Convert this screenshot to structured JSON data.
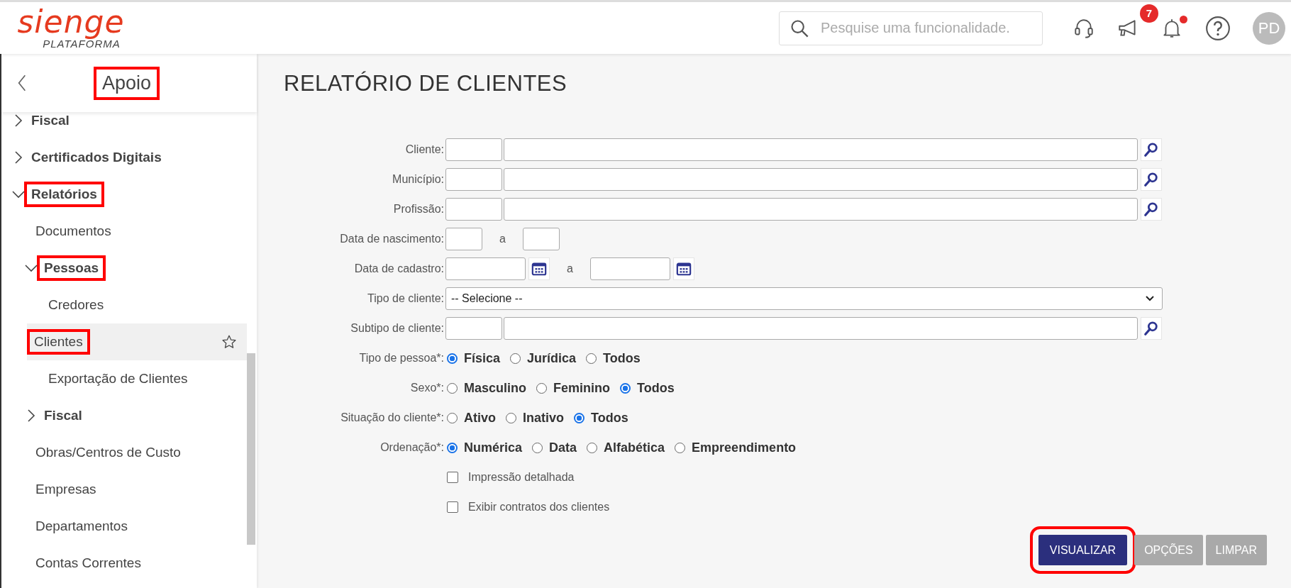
{
  "header": {
    "logo": "sienge",
    "logo_subtitle": "PLATAFORMA",
    "search": {
      "placeholder": "Pesquise uma funcionalidade."
    },
    "announcements_badge": "7",
    "notifications_unread": true,
    "avatar": "PD"
  },
  "sidebar": {
    "title": "Apoio",
    "title_highlighted": true,
    "items": [
      {
        "label": "Fiscal",
        "kind": "folder",
        "expanded": false,
        "highlighted": false
      },
      {
        "label": "Certificados Digitais",
        "kind": "folder",
        "expanded": false,
        "highlighted": false
      },
      {
        "label": "Relatórios",
        "kind": "folder",
        "expanded": true,
        "highlighted": true,
        "children": [
          {
            "label": "Documentos",
            "kind": "leaf",
            "highlighted": false,
            "selected": false
          },
          {
            "label": "Pessoas",
            "kind": "folder",
            "expanded": true,
            "highlighted": true,
            "children": [
              {
                "label": "Credores",
                "kind": "leaf",
                "highlighted": false,
                "selected": false
              },
              {
                "label": "Clientes",
                "kind": "leaf",
                "highlighted": true,
                "selected": true
              },
              {
                "label": "Exportação de Clientes",
                "kind": "leaf",
                "highlighted": false,
                "selected": false
              }
            ]
          },
          {
            "label": "Fiscal",
            "kind": "folder",
            "expanded": false,
            "highlighted": false
          },
          {
            "label": "Obras/Centros de Custo",
            "kind": "leaf",
            "highlighted": false,
            "selected": false
          },
          {
            "label": "Empresas",
            "kind": "leaf",
            "highlighted": false,
            "selected": false
          },
          {
            "label": "Departamentos",
            "kind": "leaf",
            "highlighted": false,
            "selected": false
          },
          {
            "label": "Contas Correntes",
            "kind": "leaf",
            "highlighted": false,
            "selected": false
          }
        ]
      }
    ]
  },
  "page": {
    "title": "RELATÓRIO DE CLIENTES",
    "fields": [
      {
        "kind": "lookup",
        "label": "Cliente:"
      },
      {
        "kind": "lookup",
        "label": "Município:"
      },
      {
        "kind": "lookup",
        "label": "Profissão:"
      },
      {
        "kind": "range",
        "label": "Data de nascimento:",
        "separator": "a"
      },
      {
        "kind": "date-range",
        "label": "Data de cadastro:",
        "separator": "a"
      },
      {
        "kind": "select",
        "label": "Tipo de cliente:",
        "value": "-- Selecione --"
      },
      {
        "kind": "lookup",
        "label": "Subtipo de cliente:"
      },
      {
        "kind": "radio",
        "label": "Tipo de pessoa*:",
        "options": [
          {
            "label": "Física",
            "selected": true
          },
          {
            "label": "Jurídica",
            "selected": false
          },
          {
            "label": "Todos",
            "selected": false
          }
        ]
      },
      {
        "kind": "radio",
        "label": "Sexo*:",
        "options": [
          {
            "label": "Masculino",
            "selected": false
          },
          {
            "label": "Feminino",
            "selected": false
          },
          {
            "label": "Todos",
            "selected": true
          }
        ]
      },
      {
        "kind": "radio",
        "label": "Situação do cliente*:",
        "options": [
          {
            "label": "Ativo",
            "selected": false
          },
          {
            "label": "Inativo",
            "selected": false
          },
          {
            "label": "Todos",
            "selected": true
          }
        ]
      },
      {
        "kind": "radio",
        "label": "Ordenação*:",
        "options": [
          {
            "label": "Numérica",
            "selected": true
          },
          {
            "label": "Data",
            "selected": false
          },
          {
            "label": "Alfabética",
            "selected": false
          },
          {
            "label": "Empreendimento",
            "selected": false
          }
        ]
      },
      {
        "kind": "checkbox",
        "label": "Impressão detalhada",
        "checked": false
      },
      {
        "kind": "checkbox",
        "label": "Exibir contratos dos clientes",
        "checked": false
      }
    ],
    "buttons": [
      {
        "label": "VISUALIZAR",
        "kind": "primary",
        "highlighted": true
      },
      {
        "label": "OPÇÕES",
        "kind": "secondary",
        "highlighted": false
      },
      {
        "label": "LIMPAR",
        "kind": "secondary",
        "highlighted": false
      }
    ]
  }
}
